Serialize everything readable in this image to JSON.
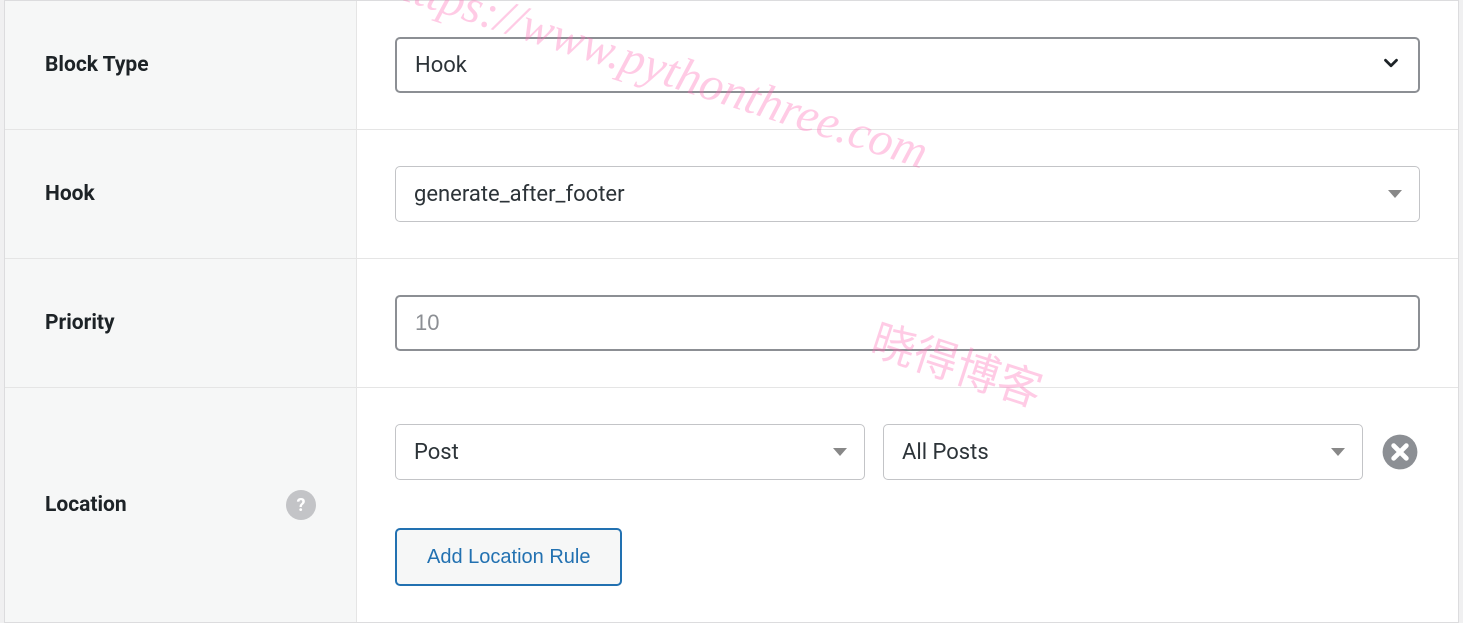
{
  "fields": {
    "block_type": {
      "label": "Block Type",
      "value": "Hook"
    },
    "hook": {
      "label": "Hook",
      "value": "generate_after_footer"
    },
    "priority": {
      "label": "Priority",
      "placeholder": "10"
    },
    "location": {
      "label": "Location",
      "rule": {
        "condition": "Post",
        "target": "All Posts"
      },
      "add_button": "Add Location Rule"
    }
  },
  "watermark": {
    "url": "https://www.pythonthree.com",
    "cn": "晓得博客"
  }
}
